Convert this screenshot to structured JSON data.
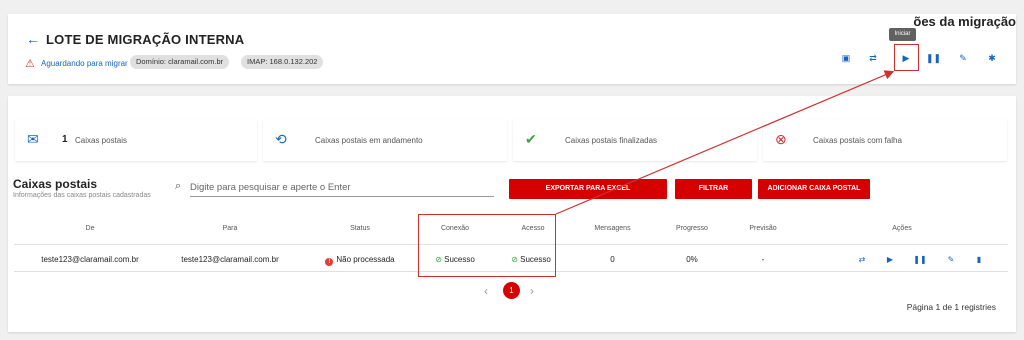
{
  "header": {
    "back_icon": "arrow-left-icon",
    "title": "LOTE DE MIGRAÇÃO INTERNA",
    "status": "Aguardando para migrar",
    "chips": [
      "Domínio: claramail.com.br",
      "IMAP: 168.0.132.202"
    ],
    "actions_title": "Ações da migração",
    "actions_title_visible": "ões da migração",
    "tooltip": "Iniciar",
    "icons": [
      "calendar-icon",
      "transfer-icon",
      "play-icon",
      "pause-icon",
      "edit-icon",
      "settings-icon"
    ]
  },
  "stats": [
    {
      "icon": "mail-icon",
      "count": "1",
      "label": "Caixas postais"
    },
    {
      "icon": "sync-icon",
      "count": "",
      "label": "Caixas postais em andamento"
    },
    {
      "icon": "check-circle-icon",
      "count": "",
      "label": "Caixas postais finalizadas"
    },
    {
      "icon": "error-circle-icon",
      "count": "",
      "label": "Caixas postais com falha"
    }
  ],
  "section": {
    "title": "Caixas postais",
    "subtitle": "Informações das caixas postais cadastradas",
    "search_placeholder": "Digite para pesquisar e aperte o Enter",
    "buttons": [
      "EXPORTAR PARA EXCEL",
      "FILTRAR",
      "ADICIONAR CAIXA POSTAL"
    ]
  },
  "table": {
    "columns": [
      "De",
      "Para",
      "Status",
      "Conexão",
      "Acesso",
      "Mensagens",
      "Progresso",
      "Previsão",
      "Ações"
    ],
    "rows": [
      {
        "de": "teste123@claramail.com.br",
        "para": "teste123@claramail.com.br",
        "status": "Não processada",
        "conexao": "Sucesso",
        "acesso": "Sucesso",
        "mensagens": "0",
        "progresso": "0%",
        "previsao": "-"
      }
    ]
  },
  "pagination": {
    "current": "1",
    "info": "Página 1 de 1 registries"
  },
  "colors": {
    "accent": "#d50000",
    "link": "#1565c0",
    "success": "#43a047",
    "annotation": "#d32f2f"
  }
}
